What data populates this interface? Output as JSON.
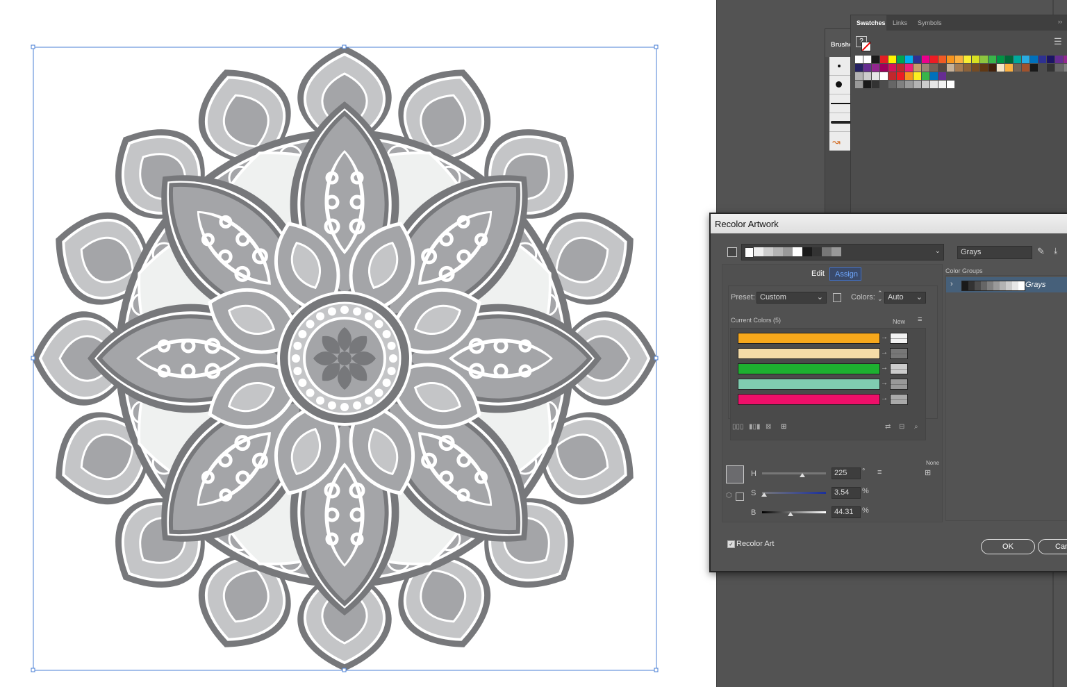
{
  "brushes_panel": {
    "tab_label": "Brushes"
  },
  "swatches_panel": {
    "tabs": [
      "Swatches",
      "Links",
      "Symbols"
    ],
    "expand_glyph": "››",
    "menu_glyph": "☰",
    "unknown_glyph": "?",
    "rows": [
      [
        "#ffffff",
        "#ffffff",
        "#1a1a1a",
        "#e31e24",
        "#fff200",
        "#00a651",
        "#00aeef",
        "#2e3192",
        "#ec008c",
        "#ed1c24",
        "#f15a24",
        "#f7941d",
        "#fbb040",
        "#f9ed32",
        "#d7e021",
        "#8dc63f",
        "#39b54a",
        "#009444",
        "#006838",
        "#00a99d",
        "#29abe2",
        "#0071bc",
        "#2e3192",
        "#1b1464",
        "#662d91",
        "#93278f",
        "#9e005d"
      ],
      [
        "#262262",
        "#662d91",
        "#92278f",
        "#9e005d",
        "#d4145a",
        "#c1272d",
        "#ed1e79",
        "#c69c6d",
        "#998675",
        "#736357",
        "#534741",
        "#c7b299",
        "#a67c52",
        "#8c6239",
        "#754c24",
        "#603813",
        "#42210b",
        "#f5e6c8",
        "#fbb040",
        "#736357",
        "#a0522d",
        "#1a1a1a",
        "#4d4d4d",
        "#333333",
        "#666666",
        "#808080"
      ],
      [
        "#b3b3b3",
        "#cccccc",
        "#e6e6e6",
        "#ffffff",
        "#c1272d",
        "#ed1c24",
        "#f7931e",
        "#fcee21",
        "#39b54a",
        "#0071bc",
        "#662d91"
      ],
      [
        "#999999",
        "#1a1a1a",
        "#333333",
        "#4d4d4d",
        "#666666",
        "#808080",
        "#999999",
        "#b3b3b3",
        "#cccccc",
        "#e6e6e6",
        "#f2f2f2",
        "#ffffff"
      ]
    ]
  },
  "dialog": {
    "title": "Recolor Artwork",
    "color_group_name": "Grays",
    "tabs": {
      "edit": "Edit",
      "assign": "Assign"
    },
    "preset_label": "Preset:",
    "preset_value": "Custom",
    "colors_label": "Colors:",
    "colors_value": "Auto",
    "current_colors_label": "Current Colors (5)",
    "new_label": "New",
    "current_colors": [
      {
        "current": "#f7a81b",
        "new": "#f2f2f2"
      },
      {
        "current": "#f5dca7",
        "new": "#777777"
      },
      {
        "current": "#1db030",
        "new": "#cccccc"
      },
      {
        "current": "#80cdb0",
        "new": "#999999"
      },
      {
        "current": "#ef0f69",
        "new": "#aaaaaa"
      }
    ],
    "h_label": "H",
    "h_value": "225",
    "h_unit": "°",
    "h_level": 0.625,
    "s_label": "S",
    "s_value": "3.54",
    "s_unit": "%",
    "s_level": 0.0354,
    "b_label": "B",
    "b_value": "44.31",
    "b_unit": "%",
    "b_level": 0.4431,
    "none_label": "None",
    "recolor_art_label": "Recolor Art",
    "recolor_art_checked": true,
    "ok_label": "OK",
    "cancel_label": "Can",
    "color_groups_label": "Color Groups",
    "color_groups": [
      {
        "name": "Grays"
      }
    ]
  },
  "artwork": {
    "colors": {
      "dark": "#77787b",
      "mid": "#a4a5a8",
      "light": "#c4c5c7",
      "pale": "#eff1f0",
      "white": "#ffffff"
    }
  }
}
